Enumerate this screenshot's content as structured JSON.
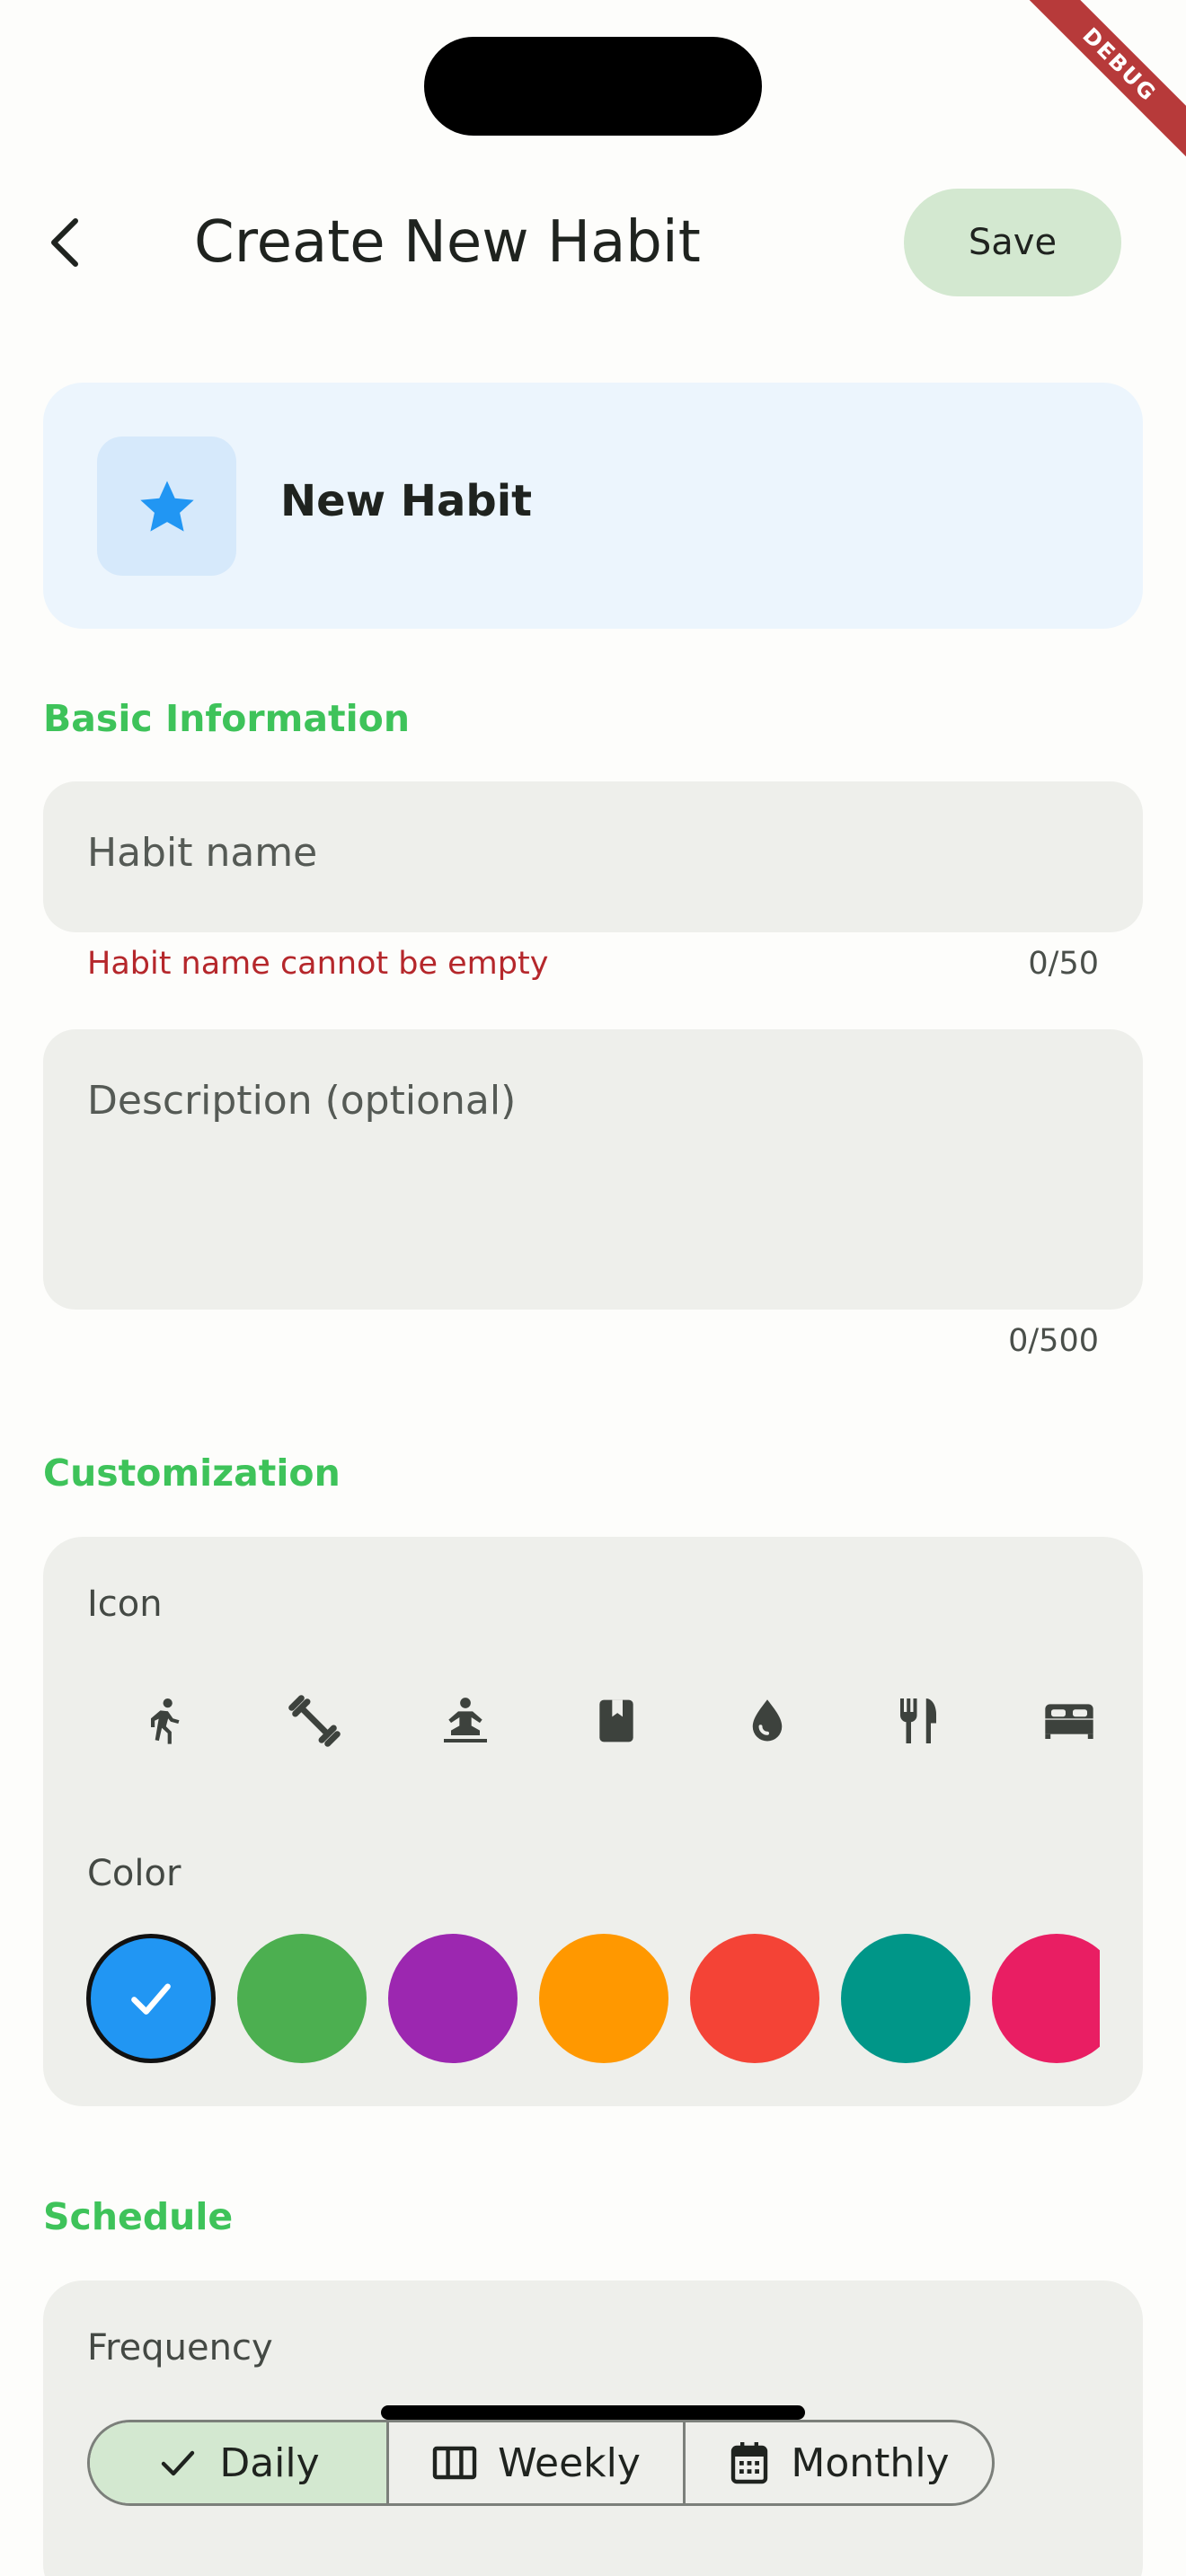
{
  "app": {
    "debug_banner": "DEBUG",
    "title": "Create New Habit",
    "save_label": "Save"
  },
  "preview": {
    "name": "New Habit",
    "icon": "star-icon",
    "color": "#2196f3"
  },
  "basic_info": {
    "section_title": "Basic Information",
    "name_placeholder": "Habit name",
    "name_value": "",
    "name_error": "Habit name cannot be empty",
    "name_counter": "0/50",
    "description_placeholder": "Description (optional)",
    "description_value": "",
    "description_counter": "0/500"
  },
  "customization": {
    "section_title": "Customization",
    "icon_label": "Icon",
    "icons": [
      "running-icon",
      "dumbbell-icon",
      "meditation-icon",
      "book-icon",
      "water-drop-icon",
      "restaurant-icon",
      "bed-icon"
    ],
    "color_label": "Color",
    "colors": [
      "#2196f3",
      "#4caf50",
      "#9c27b0",
      "#ff9800",
      "#f44336",
      "#009688",
      "#e91e63"
    ],
    "selected_color": "#2196f3"
  },
  "schedule": {
    "section_title": "Schedule",
    "frequency_label": "Frequency",
    "options": [
      {
        "label": "Daily",
        "icon": "check-icon",
        "selected": true
      },
      {
        "label": "Weekly",
        "icon": "calendar-view-week-icon",
        "selected": false
      },
      {
        "label": "Monthly",
        "icon": "calendar-month-icon",
        "selected": false
      }
    ]
  }
}
